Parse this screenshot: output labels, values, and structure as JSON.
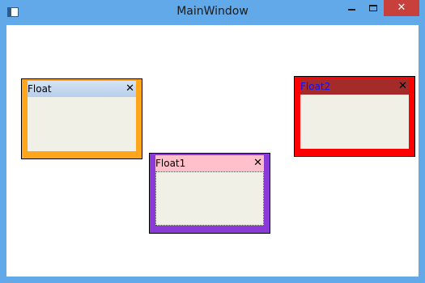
{
  "window": {
    "title": "MainWindow",
    "close_glyph": "✕",
    "frame_color": "#62a9ea",
    "close_color": "#c7403b"
  },
  "floats": [
    {
      "title": "Float",
      "close_glyph": "✕",
      "border_color": "#ffa61a",
      "header_color": "#c6d9f1",
      "body_color": "#f1f0e6"
    },
    {
      "title": "Float1",
      "close_glyph": "✕",
      "border_color": "#8a3ad6",
      "header_color": "#ffc0cb",
      "body_color": "#f1f0e6"
    },
    {
      "title": "Float2",
      "close_glyph": "✕",
      "border_color": "#ff0000",
      "header_color": "#a52a2a",
      "title_color": "#1010ff",
      "body_color": "#f1f0e6"
    }
  ]
}
